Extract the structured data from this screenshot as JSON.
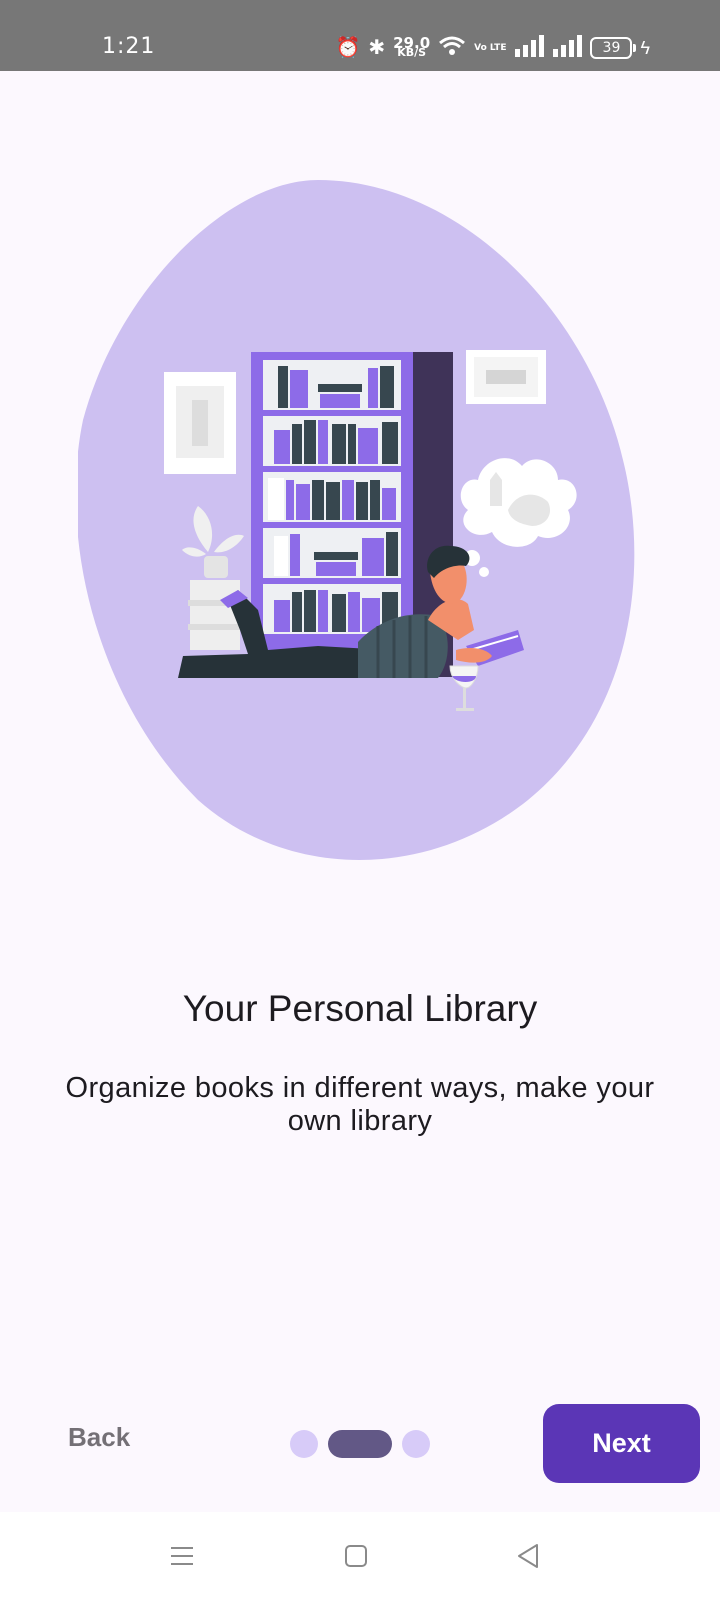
{
  "status_bar": {
    "time": "1:21",
    "network_speed_value": "29.0",
    "network_speed_unit": "KB/S",
    "volte_label": "Vo LTE",
    "battery_level": "39",
    "icons": [
      "alarm-icon",
      "bluetooth-icon",
      "wifi-icon",
      "signal-icon",
      "signal-icon",
      "battery-icon",
      "charging-icon"
    ]
  },
  "onboarding": {
    "title": "Your Personal Library",
    "description": "Organize books in different ways, make your own library",
    "illustration": "person-reading-by-bookshelf-illustration",
    "page_index": 2,
    "page_count": 3
  },
  "controls": {
    "back_label": "Back",
    "next_label": "Next"
  },
  "nav_bar": {
    "icons": [
      "menu-icon",
      "home-square-icon",
      "back-triangle-icon"
    ]
  },
  "colors": {
    "background": "#fcf8fe",
    "blob": "#cdc0f1",
    "accent": "#5b36b6",
    "active_dot": "#625886",
    "inactive_dot": "#d7cbf8"
  }
}
